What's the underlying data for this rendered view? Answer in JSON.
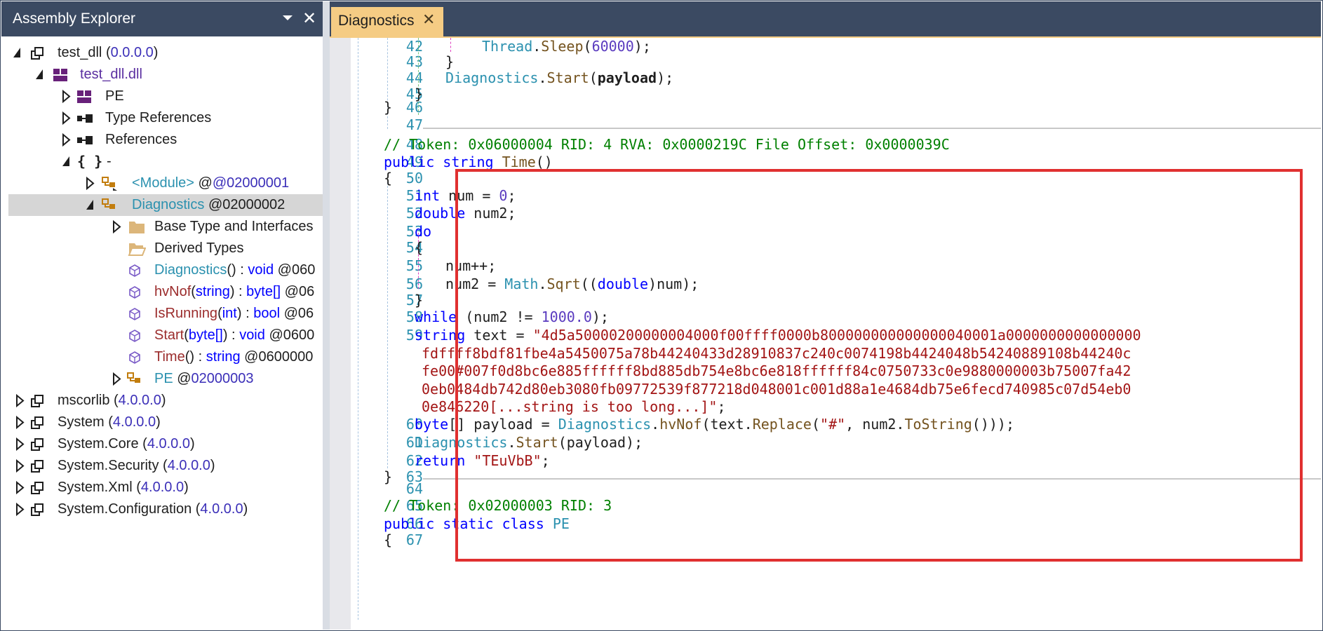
{
  "explorer": {
    "title": "Assembly Explorer",
    "tree": [
      {
        "name": "test_dll",
        "version": "(0.0.0.0)",
        "ver_num": "0.0.0.0"
      },
      {
        "name": "test_dll.dll"
      },
      {
        "name": "PE"
      },
      {
        "name": "Type References"
      },
      {
        "name": "References"
      },
      {
        "name": "-"
      },
      {
        "name": "<Module>",
        "id": "@02000001"
      },
      {
        "name": "Diagnostics",
        "id": "@02000002"
      },
      {
        "name": "Base Type and Interfaces"
      },
      {
        "name": "Derived Types"
      },
      {
        "name": "Diagnostics",
        "sig": "()",
        "ret": "void",
        "id": "@060"
      },
      {
        "name": "hvNof",
        "param": "string",
        "ret": "byte[]",
        "id": "@06"
      },
      {
        "name": "IsRunning",
        "param": "int",
        "ret": "bool",
        "id": "@06"
      },
      {
        "name": "Start",
        "param": "byte[]",
        "ret": "void",
        "id": "@0600"
      },
      {
        "name": "Time",
        "sig": "()",
        "ret": "string",
        "id": "@0600000"
      },
      {
        "name": "PE",
        "id": "@02000003"
      },
      {
        "name": "mscorlib",
        "version": "4.0.0.0"
      },
      {
        "name": "System",
        "version": "4.0.0.0"
      },
      {
        "name": "System.Core",
        "version": "4.0.0.0"
      },
      {
        "name": "System.Security",
        "version": "4.0.0.0"
      },
      {
        "name": "System.Xml",
        "version": "4.0.0.0"
      },
      {
        "name": "System.Configuration",
        "version": "4.0.0.0"
      }
    ]
  },
  "editor": {
    "tab_label": "Diagnostics",
    "line_numbers": [
      "42",
      "43",
      "44",
      "45",
      "46",
      "47",
      "48",
      "49",
      "50",
      "51",
      "52",
      "53",
      "54",
      "55",
      "56",
      "57",
      "58",
      "59",
      "60",
      "61",
      "62",
      "63",
      "64",
      "65",
      "66",
      "67"
    ],
    "comment_48": "// Token: 0x06000004 RID: 4 RVA: 0x0000219C File Offset: 0x0000039C",
    "comment_65": "// Token: 0x02000003 RID: 3",
    "sleep_arg": "60000",
    "zero": "0",
    "limit": "1000.0",
    "string_lines": [
      "\"4d5a50000200000004000f00ffff0000b800000000000000040001a0000000000000000",
      "fdffff8bdf81fbe4a5450075a78b44240433d28910837c240c0074198b4424048b54240889108b44240c",
      "fe00#007f0d8bc6e885ffffff8bd885db754e8bc6e818ffffff84c0750733c0e9880000003b75007fa42",
      "0eb0484db742d80eb3080fb09772539f877218d048001c001d88a1e4684db75e6fecd740985c07d54eb0",
      "0e846220[...string is too long...]\""
    ],
    "replace_arg": "\"#\"",
    "return_value": "\"TEuVbB\""
  }
}
